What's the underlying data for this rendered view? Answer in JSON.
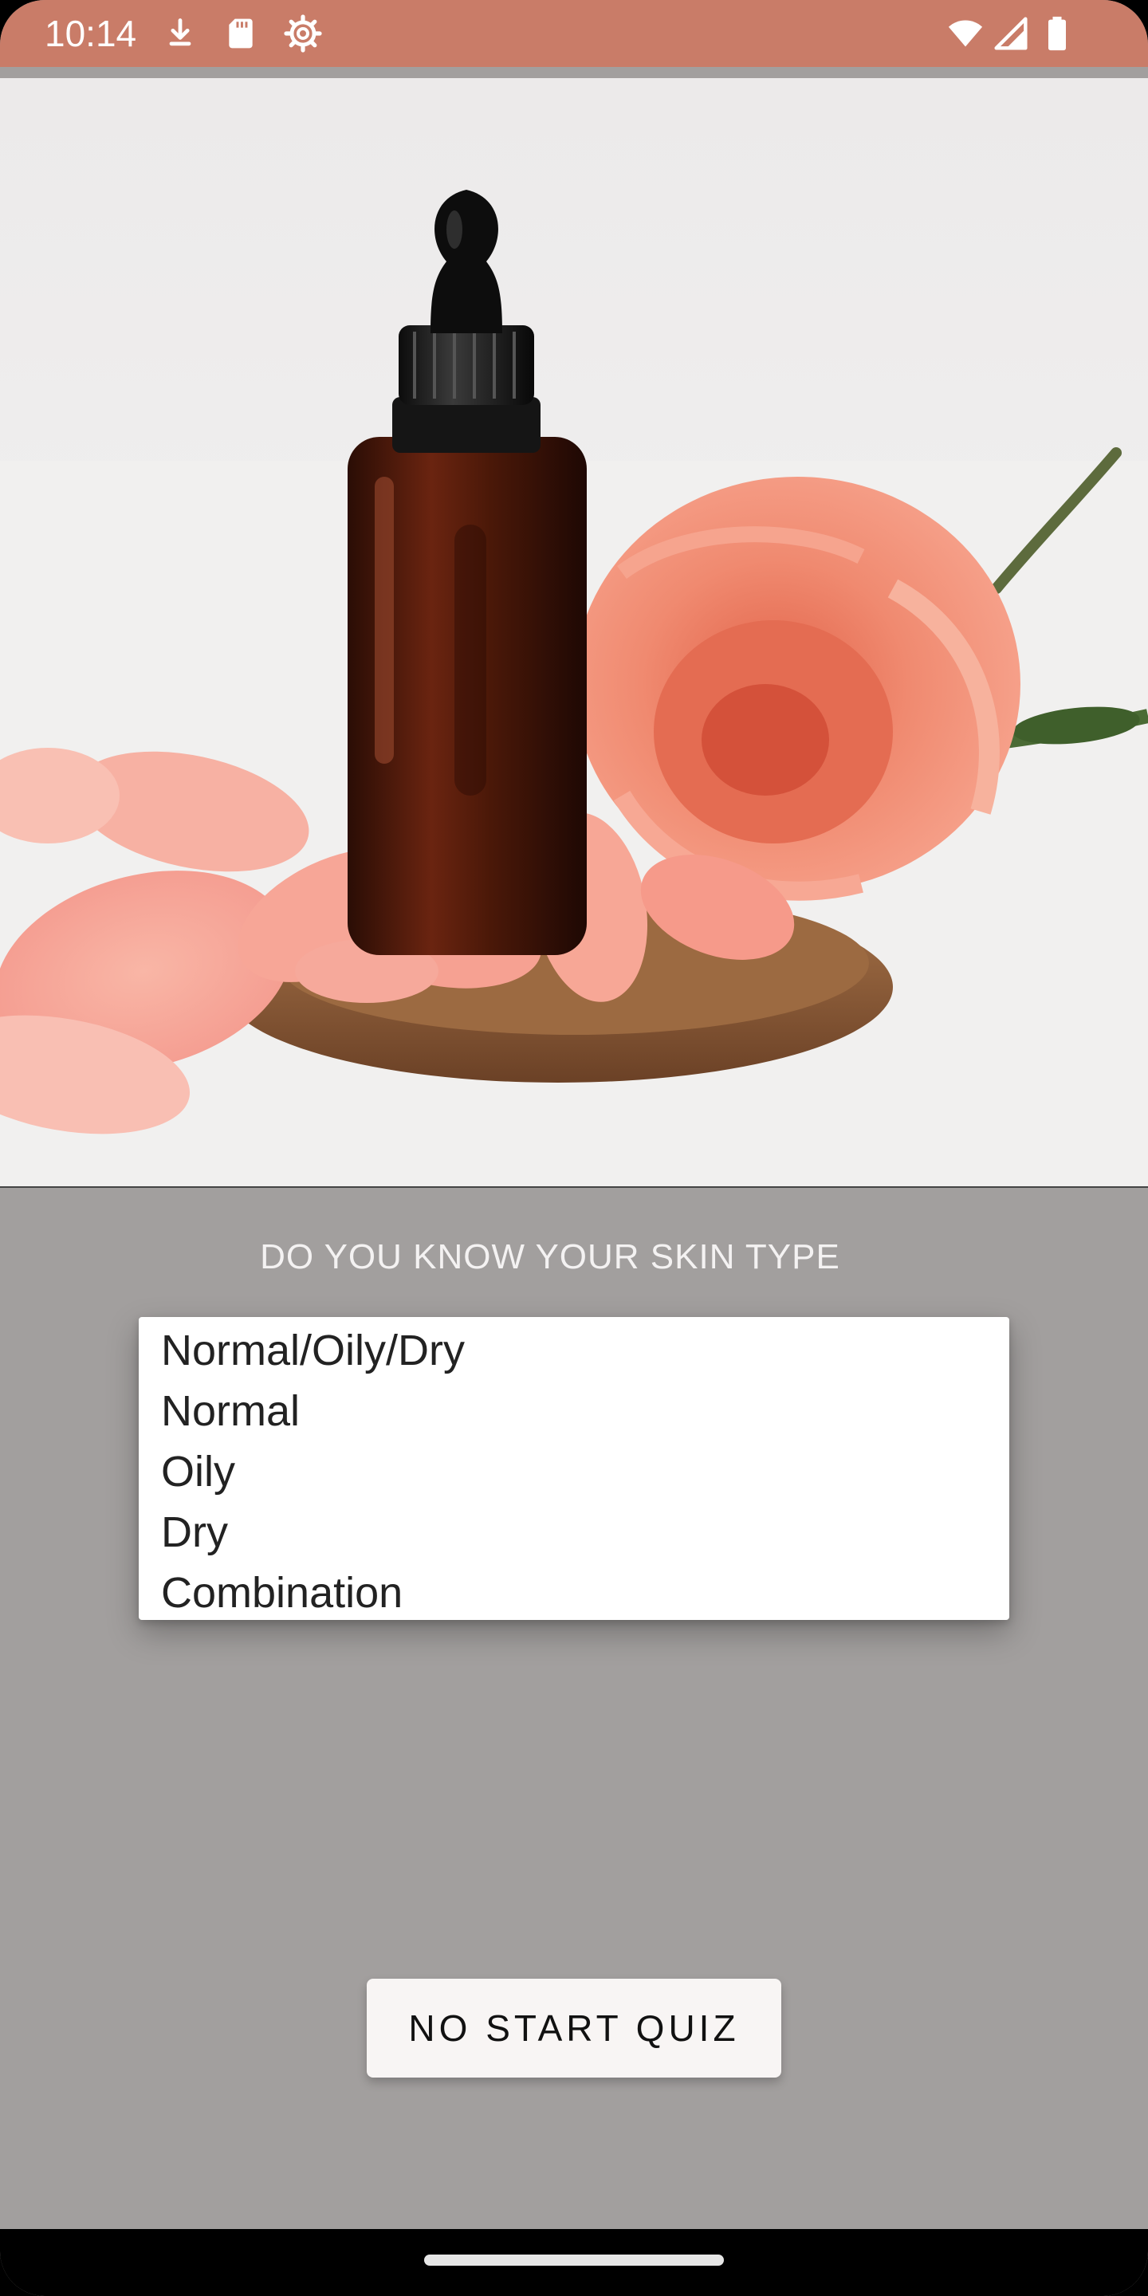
{
  "status_bar": {
    "time": "10:14",
    "left_icons": [
      "download-icon",
      "sd-card-icon",
      "settings-gear-icon"
    ],
    "right_icons": [
      "wifi-icon",
      "signal-icon",
      "battery-icon"
    ],
    "background_color": "#c97c68"
  },
  "hero": {
    "image_subject": "serum-dropper-bottle-with-rose-and-petals"
  },
  "question": {
    "text": "DO YOU KNOW YOUR SKIN TYPE"
  },
  "skin_type_dropdown": {
    "options": [
      "Normal/Oily/Dry",
      "Normal",
      "Oily",
      "Dry",
      "Combination"
    ]
  },
  "quiz_button": {
    "label": "NO START QUIZ"
  },
  "colors": {
    "page_background": "#a29f9e",
    "button_background": "#f8f5f4"
  }
}
